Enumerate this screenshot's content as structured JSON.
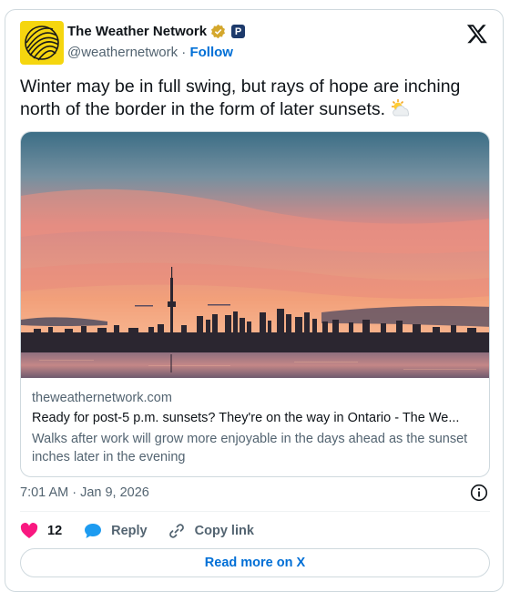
{
  "account": {
    "name": "The Weather Network",
    "handle": "@weathernetwork",
    "separator": "·",
    "follow_label": "Follow",
    "badge_letter": "P",
    "verified_icon": "verified-badge-icon",
    "avatar_icon": "weather-network-logo-icon"
  },
  "tweet": {
    "text": "Winter may be in full swing, but rays of hope are inching north of the border in the form of later sunsets.",
    "emoji_icon": "sun-behind-cloud-icon"
  },
  "link_card": {
    "domain": "theweathernetwork.com",
    "title": "Ready for post-5 p.m. sunsets? They're on the way in Ontario - The We...",
    "description": "Walks after work will grow more enjoyable in the days ahead as the sunset inches later in the evening",
    "image_icon": "toronto-skyline-sunset-photo"
  },
  "timestamp": "7:01 AM · Jan 9, 2026",
  "actions": {
    "like_count": "12",
    "reply_label": "Reply",
    "copy_link_label": "Copy link"
  },
  "read_more_label": "Read more on X",
  "colors": {
    "accent": "#006fd6",
    "like": "#f91880",
    "reply": "#1d9bf0",
    "secondary_text": "#536471",
    "border": "#cfd9de"
  }
}
